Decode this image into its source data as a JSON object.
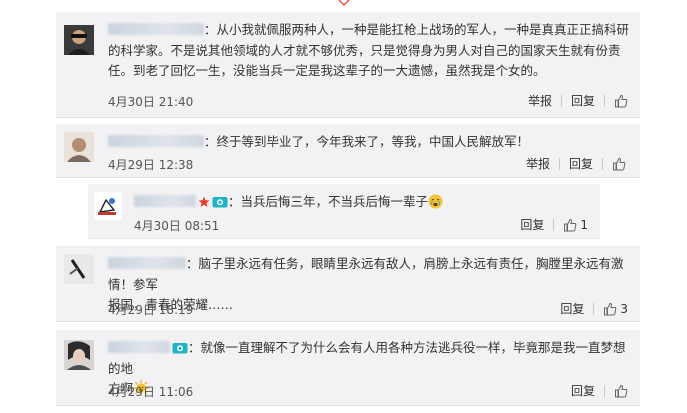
{
  "comments": [
    {
      "text": "从小我就佩服两种人，一种是能扛枪上战场的军人，一种是真真正正搞科研的科学家。不是说其他领域的人才就不够优秀，只是觉得身为男人对自己的国家天生就有份责任。到老了回忆一生，没能当兵一定是我这辈子的一大遗憾，虽然我是个女的。",
      "time": "4月30日 21:40",
      "report": "举报",
      "reply": "回复",
      "like_count": ""
    },
    {
      "text": "终于等到毕业了，今年我来了，等我，中国人民解放军！",
      "time": "4月29日 12:38",
      "report": "举报",
      "reply": "回复",
      "like_count": ""
    },
    {
      "text": "当兵后悔三年，不当兵后悔一辈子",
      "time": "4月30日 08:51",
      "reply": "回复",
      "like_count": "1"
    },
    {
      "text_line1": "脑子里永远有任务，眼睛里永远有敌人，肩膀上永远有责任，胸膛里永远有激情！参军",
      "text_line2": "报国，青春的荣耀……",
      "time": "4月29日 18:19",
      "reply": "回复",
      "like_count": "3"
    },
    {
      "text_line1": "就像一直理解不了为什么会有人用各种方法逃兵役一样，毕竟那是我一直梦想的地",
      "text_line2": "方啊",
      "time": "4月29日 11:06",
      "reply": "回复",
      "like_count": ""
    }
  ],
  "colon": "："
}
